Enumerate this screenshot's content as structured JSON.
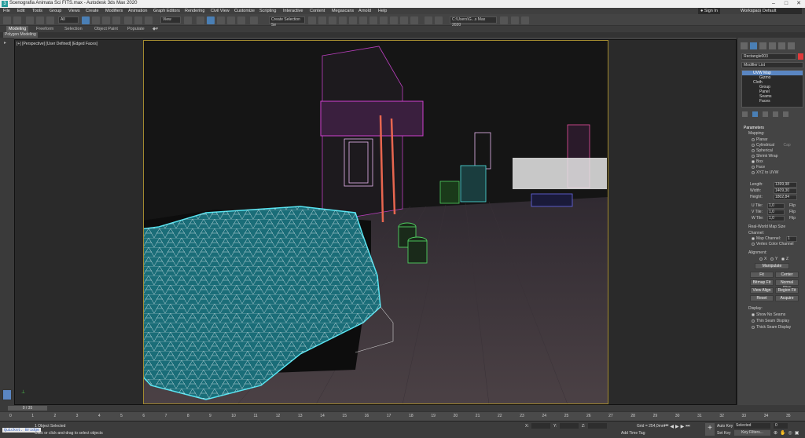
{
  "window": {
    "title": "Scenografia Animata Sci FITS.max - Autodesk 3ds Max 2020",
    "minimize": "–",
    "maximize": "□",
    "close": "✕"
  },
  "menu": [
    "File",
    "Edit",
    "Tools",
    "Group",
    "Views",
    "Create",
    "Modifiers",
    "Animation",
    "Graph Editors",
    "Rendering",
    "Civil View",
    "Customize",
    "Scripting",
    "Interactive",
    "Content",
    "Megascans",
    "Arnold",
    "Help"
  ],
  "signin": "Sign In",
  "workspaces": {
    "label": "Workspaces:",
    "value": "Default"
  },
  "toolbar": {
    "view_dropdown": "View",
    "selection_set": "Create Selection Se",
    "path_field": "C:\\Users\\G...s Max 2020"
  },
  "ribbon": {
    "tabs": [
      "Modeling",
      "Freeform",
      "Selection",
      "Object Paint",
      "Populate"
    ],
    "active": "Modeling",
    "sub": "Polygon Modeling"
  },
  "viewport": {
    "label": "[+] [Perspective] [User Defined] [Edged Faces]"
  },
  "command_panel": {
    "object_name": "Rectangle003",
    "modifier_list": "Modifier List",
    "stack": [
      {
        "label": "UVW Map",
        "selected": true
      },
      {
        "label": "Gizmo",
        "selected": false
      },
      {
        "label": "Cloth",
        "selected": false
      },
      {
        "label": "Group",
        "selected": false
      },
      {
        "label": "Panel",
        "selected": false
      },
      {
        "label": "Seams",
        "selected": false
      },
      {
        "label": "Faces",
        "selected": false
      }
    ],
    "parameters_title": "Parameters",
    "mapping_label": "Mapping:",
    "mapping_options": [
      "Planar",
      "Cylindrical",
      "Spherical",
      "Shrink Wrap",
      "Box",
      "Face",
      "XYZ to UVW"
    ],
    "mapping_selected": "Box",
    "cap_label": "Cap",
    "length": {
      "label": "Length:",
      "value": "1399,98"
    },
    "width": {
      "label": "Width:",
      "value": "1409,30"
    },
    "height": {
      "label": "Height:",
      "value": "1802,84"
    },
    "utile": {
      "label": "U Tile:",
      "value": "1,0"
    },
    "vtile": {
      "label": "V Tile:",
      "value": "1,0"
    },
    "wtile": {
      "label": "W Tile:",
      "value": "1,0"
    },
    "flip": "Flip",
    "real_world": "Real-World Map Size",
    "channel_label": "Channel:",
    "map_channel": {
      "label": "Map Channel:",
      "value": "1"
    },
    "vertex_color": "Vertex Color Channel",
    "alignment_label": "Alignment:",
    "axes": [
      "X",
      "Y",
      "Z"
    ],
    "axis_selected": "Z",
    "manipulate": "Manipulate",
    "buttons": [
      [
        "Fit",
        "Center"
      ],
      [
        "Bitmap Fit",
        "Normal Align"
      ],
      [
        "View Align",
        "Region Fit"
      ],
      [
        "Reset",
        "Acquire"
      ]
    ],
    "display_label": "Display:",
    "display_options": [
      "Show No Seams",
      "Thin Seam Display",
      "Thick Seam Display"
    ],
    "display_selected": "Show No Seams"
  },
  "timeline": {
    "frame": "0 / 35",
    "ticks": [
      "0",
      "1",
      "2",
      "3",
      "4",
      "5",
      "6",
      "7",
      "8",
      "9",
      "10",
      "11",
      "12",
      "13",
      "14",
      "15",
      "16",
      "17",
      "18",
      "19",
      "20",
      "21",
      "22",
      "23",
      "24",
      "25",
      "26",
      "27",
      "28",
      "29",
      "30",
      "31",
      "32",
      "33",
      "34",
      "35"
    ]
  },
  "status": {
    "maxscript": "Quickst. Bridge",
    "selected": "1 Object Selected",
    "hint": "Click or click-and-drag to select objects",
    "x_label": "X:",
    "y_label": "Y:",
    "z_label": "Z:",
    "grid": "Grid = 254,0mm",
    "add_time_tag": "Add Time Tag",
    "auto_key": "Auto Key",
    "set_key": "Set Key",
    "key_selected": "Selected",
    "key_filters": "Key Filters...",
    "frame_value": "0"
  },
  "colors": {
    "accent": "#5a86c2",
    "selection_cyan": "#55e3f0",
    "safe_frame": "#a28a2f",
    "magenta": "#d040d0",
    "green": "#50d060"
  }
}
